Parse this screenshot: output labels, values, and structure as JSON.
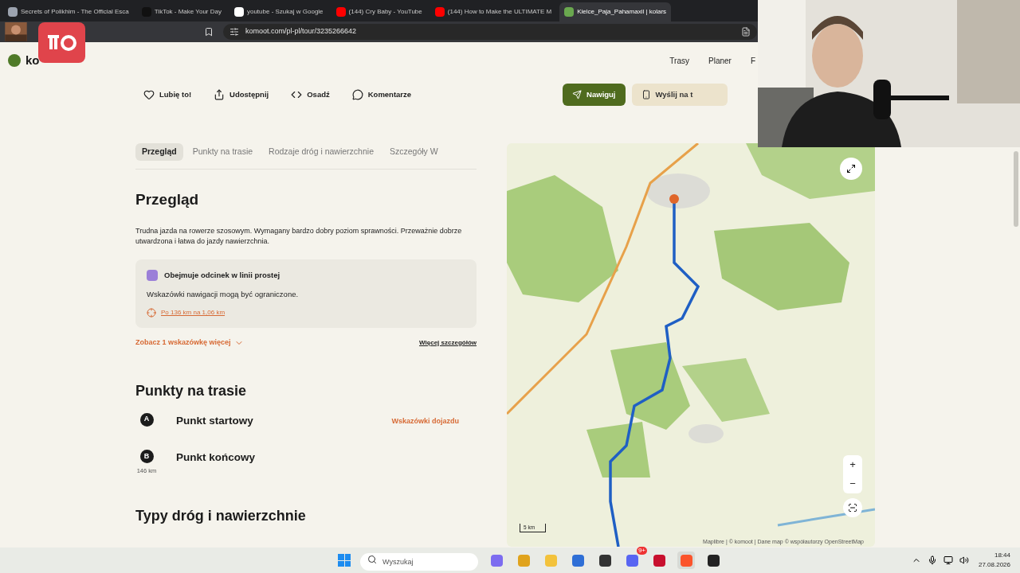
{
  "browser": {
    "tabs": [
      {
        "title": "Secrets of Polikhim - The Official Esca",
        "kind": "game",
        "selected": false
      },
      {
        "title": "TikTok - Make Your Day",
        "kind": "tiktok",
        "selected": false
      },
      {
        "title": "youtube - Szukaj w Google",
        "kind": "google",
        "selected": false
      },
      {
        "title": "(144) Cry Baby - YouTube",
        "kind": "youtube",
        "selected": false
      },
      {
        "title": "(144) How to Make the ULTIMATE M",
        "kind": "youtube",
        "selected": false
      },
      {
        "title": "Kielce_Paja_Pahamaxil | kolars",
        "kind": "komoot",
        "selected": true
      }
    ],
    "address": "komoot.com/pl-pl/tour/3235266642"
  },
  "header": {
    "logo": "ko",
    "nav": [
      "Trasy",
      "Planer",
      "F"
    ]
  },
  "actions": [
    {
      "label": "Lubię to!",
      "kind": "heart"
    },
    {
      "label": "Udostępnij",
      "kind": "share"
    },
    {
      "label": "Osadź",
      "kind": "code"
    },
    {
      "label": "Komentarze",
      "kind": "comment"
    }
  ],
  "primary_buttons": [
    {
      "label": "Nawiguj",
      "kind": "primary"
    },
    {
      "label": "Wyślij na t",
      "kind": "secondary"
    }
  ],
  "section_tabs": [
    {
      "label": "Przegląd",
      "selected": true
    },
    {
      "label": "Punkty na trasie",
      "selected": false
    },
    {
      "label": "Rodzaje dróg i nawierzchnie",
      "selected": false
    },
    {
      "label": "Szczegóły W",
      "selected": false
    }
  ],
  "overview": {
    "heading": "Przegląd",
    "text": "Trudna jazda na rowerze szosowym. Wymagany bardzo dobry poziom sprawności. Przeważnie dobrze utwardzona i łatwa do jazdy nawierzchnia.",
    "notice": {
      "title": "Obejmuje odcinek w linii prostej",
      "text": "Wskazówki nawigacji mogą być ograniczone.",
      "link": "Po 136 km na 1,06 km"
    },
    "more_tips": "Zobacz 1 wskazówkę więcej",
    "more_details": "Więcej szczegółów"
  },
  "waypoints": {
    "heading": "Punkty na trasie",
    "items": [
      {
        "marker": "A",
        "name": "Punkt startowy",
        "link": "Wskazówki dojazdu"
      },
      {
        "marker": "B",
        "name": "Punkt końcowy",
        "distance": "146 km"
      }
    ]
  },
  "surfaces": {
    "heading": "Typy dróg i nawierzchnie"
  },
  "map": {
    "kind": "picture",
    "scale": "5 km",
    "attribution": "Maplibre | © komoot | Dane map © współautorzy OpenStreetMap",
    "zoom_in": "+",
    "zoom_out": "−"
  },
  "taskbar": {
    "search_placeholder": "Wyszukaj",
    "apps": [
      {
        "kind": "copilot"
      },
      {
        "kind": "chrome"
      },
      {
        "kind": "folder"
      },
      {
        "kind": "store"
      },
      {
        "kind": "app"
      },
      {
        "kind": "discord",
        "badge": "9+"
      },
      {
        "kind": "amd"
      },
      {
        "kind": "brave",
        "selected": true
      },
      {
        "kind": "obs"
      }
    ],
    "time": "18:44",
    "date": "27.08.2026"
  }
}
